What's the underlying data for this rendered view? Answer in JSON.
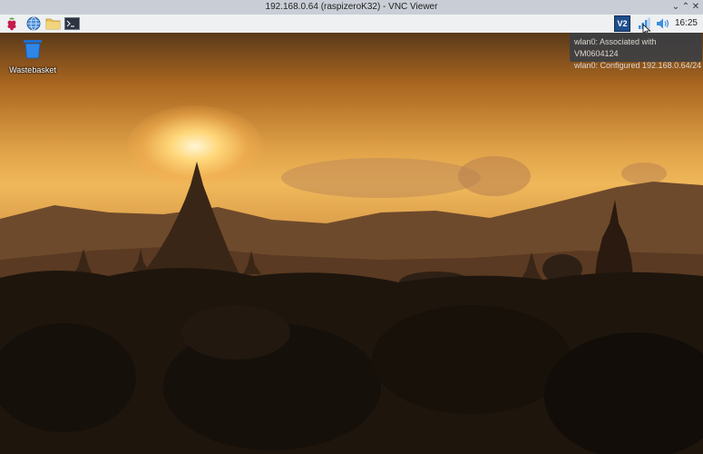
{
  "window": {
    "title": "192.168.0.64 (raspizeroK32) - VNC Viewer",
    "buttons": {
      "minimize": "⌄",
      "maximize": "⌃",
      "close": "✕"
    }
  },
  "taskbar": {
    "launchers": [
      {
        "name": "raspberry-menu-icon"
      },
      {
        "name": "browser-globe-icon"
      },
      {
        "name": "file-manager-icon"
      },
      {
        "name": "terminal-icon"
      }
    ],
    "tray": {
      "vnc_icon_label": "V2",
      "clock": "16:25"
    }
  },
  "desktop": {
    "icons": [
      {
        "label": "Wastebasket"
      }
    ],
    "wallpaper": "Sunset over temples"
  },
  "tooltip": {
    "line1": "wlan0: Associated with VM0604124",
    "line2": "wlan0: Configured 192.168.0.64/24"
  },
  "colors": {
    "taskbar_bg": "#eef0f2",
    "tooltip_bg": "#3b3f44",
    "accent": "#2f6db3"
  }
}
